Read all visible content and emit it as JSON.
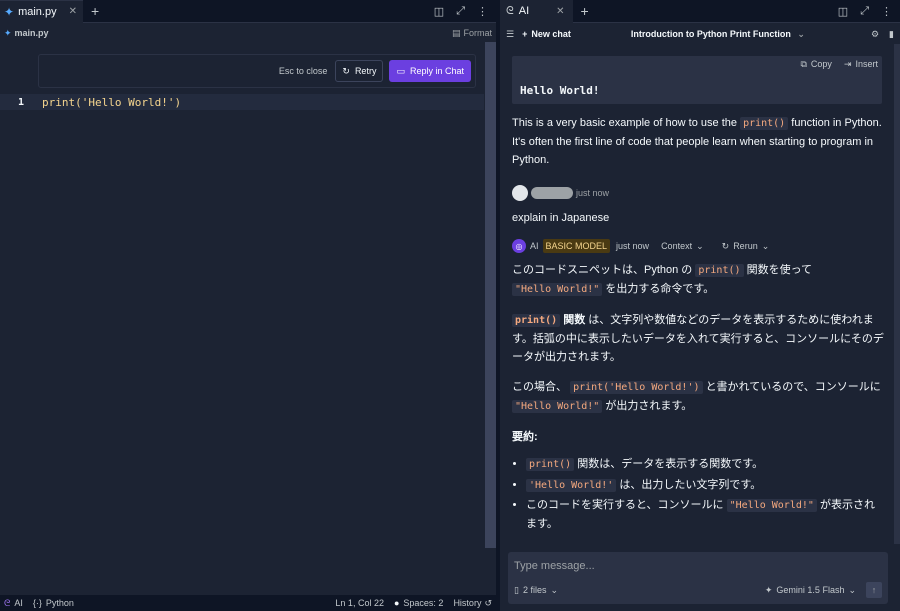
{
  "left": {
    "tab_name": "main.py",
    "filename": "main.py",
    "format_label": "Format",
    "esc_label": "Esc to close",
    "retry_label": "Retry",
    "reply_label": "Reply in Chat",
    "line_number": "1",
    "code": "print('Hello World!')",
    "status": {
      "ai_label": "AI",
      "language": "Python",
      "position": "Ln 1, Col 22",
      "spaces": "Spaces: 2",
      "history": "History"
    }
  },
  "right": {
    "tab_name": "AI",
    "new_chat_label": "New chat",
    "chat_title": "Introduction to Python Print Function",
    "copy_label": "Copy",
    "insert_label": "Insert",
    "codeblock_text": "Hello World!",
    "msg1_a": "This is a very basic example of how to use the",
    "msg1_code": "print()",
    "msg1_b": "function in Python. It's often the first line of code that people learn when starting to program in Python.",
    "user_time": "just now",
    "user_message": "explain in Japanese",
    "ai_label": "AI",
    "badge": "BASIC MODEL",
    "ai_time": "just now",
    "context_label": "Context",
    "rerun_label": "Rerun",
    "jp1_a": "このコードスニペットは、Python の",
    "jp1_code1": "print()",
    "jp1_b": "関数を使って",
    "jp1_code2": "\"Hello World!\"",
    "jp1_c": "を出力する命令です。",
    "jp2_code": "print()",
    "jp2_bold": "関数",
    "jp2_text": "は、文字列や数値などのデータを表示するために使われます。括弧の中に表示したいデータを入れて実行すると、コンソールにそのデータが出力されます。",
    "jp3_a": "この場合、",
    "jp3_code1": "print('Hello World!')",
    "jp3_b": "と書かれているので、コンソールに",
    "jp3_code2": "\"Hello World!\"",
    "jp3_c": "が出力されます。",
    "summary_heading": "要約:",
    "bullets": [
      {
        "code": "print()",
        "text": "関数は、データを表示する関数です。"
      },
      {
        "code": "'Hello World!'",
        "text": "は、出力したい文字列です。"
      },
      {
        "pre": "このコードを実行すると、コンソールに",
        "code": "\"Hello World!\"",
        "text": "が表示されます。"
      }
    ],
    "input_placeholder": "Type message...",
    "files_label": "2 files",
    "model_label": "Gemini 1.5 Flash"
  }
}
